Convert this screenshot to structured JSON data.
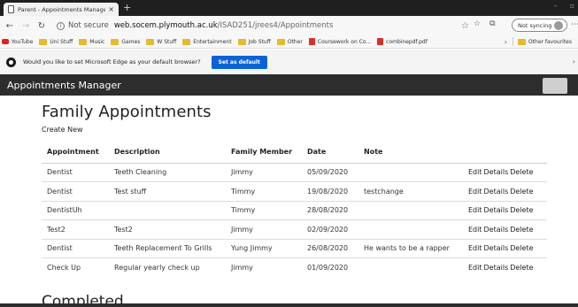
{
  "browser": {
    "tab_title": "Parent - Appointments Manager",
    "tab_close": "×",
    "new_tab": "+",
    "address_prefix": "Not secure",
    "address_host": "web.socem.plymouth.ac.uk",
    "address_path": "/ISAD251/jrees4/Appointments",
    "sync_label": "Not syncing",
    "bookmarks": [
      {
        "label": "YouTube",
        "icon": "youtube-icon"
      },
      {
        "label": "Uni Stuff",
        "icon": "folder-icon"
      },
      {
        "label": "Music",
        "icon": "folder-icon"
      },
      {
        "label": "Games",
        "icon": "folder-icon"
      },
      {
        "label": "W Stuff",
        "icon": "folder-icon"
      },
      {
        "label": "Entertainment",
        "icon": "folder-icon"
      },
      {
        "label": "Job Stuff",
        "icon": "folder-icon"
      },
      {
        "label": "Other",
        "icon": "folder-icon"
      },
      {
        "label": "Coursework on Co...",
        "icon": "pdf-icon"
      },
      {
        "label": "combinepdf.pdf",
        "icon": "pdf-icon"
      }
    ],
    "other_favourites": "Other favourites",
    "banner_text": "Would you like to set Microsoft Edge as your default browser?",
    "banner_button": "Set as default"
  },
  "navbar": {
    "brand": "Appointments Manager"
  },
  "page": {
    "title": "Family Appointments",
    "create_new": "Create New",
    "completed_heading": "Completed"
  },
  "table": {
    "headers": {
      "appointment": "Appointment",
      "description": "Description",
      "family_member": "Family Member",
      "date": "Date",
      "note": "Note"
    },
    "rows": [
      {
        "appointment": "Dentist",
        "description": "Teeth Cleaning",
        "family_member": "Jimmy",
        "date": "05/09/2020",
        "note": ""
      },
      {
        "appointment": "Dentist",
        "description": "Test stuff",
        "family_member": "Timmy",
        "date": "19/08/2020",
        "note": "testchange"
      },
      {
        "appointment": "DentistUh",
        "description": "",
        "family_member": "Timmy",
        "date": "28/08/2020",
        "note": ""
      },
      {
        "appointment": "Test2",
        "description": "Test2",
        "family_member": "Jimmy",
        "date": "02/09/2020",
        "note": ""
      },
      {
        "appointment": "Dentist",
        "description": "Teeth Replacement To Grills",
        "family_member": "Yung Jimmy",
        "date": "26/08/2020",
        "note": "He wants to be a rapper"
      },
      {
        "appointment": "Check Up",
        "description": "Regular yearly check up",
        "family_member": "Jimmy",
        "date": "01/09/2020",
        "note": ""
      }
    ],
    "actions": {
      "edit": "Edit",
      "details": "Details",
      "delete": "Delete"
    }
  },
  "colors": {
    "navbar_bg": "#2d2d2d",
    "banner_button_bg": "#0b62d6",
    "folder": "#e8b830"
  }
}
